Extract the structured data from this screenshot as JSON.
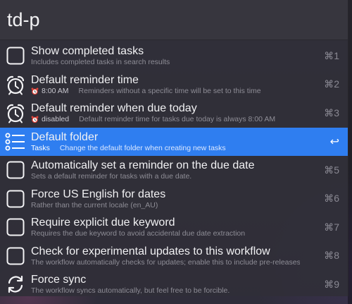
{
  "search": {
    "query": "td-p"
  },
  "results": [
    {
      "icon": "checkbox-icon",
      "title": "Show completed tasks",
      "prefix": "",
      "subtitle": "Includes completed tasks in search results",
      "shortcut": "⌘1",
      "selected": false
    },
    {
      "icon": "alarm-clock-icon",
      "title": "Default reminder time",
      "prefix": "8:00 AM",
      "subtitle": "Reminders without a specific time will be set to this time",
      "shortcut": "⌘2",
      "selected": false
    },
    {
      "icon": "alarm-clock-icon",
      "title": "Default reminder when due today",
      "prefix": "disabled",
      "subtitle": "Default reminder time for tasks due today is always 8:00 AM",
      "shortcut": "⌘3",
      "selected": false
    },
    {
      "icon": "list-icon",
      "title": "Default folder",
      "prefix": "Tasks",
      "subtitle": "Change the default folder when creating new tasks",
      "shortcut": "↩",
      "selected": true
    },
    {
      "icon": "checkbox-icon",
      "title": "Automatically set a reminder on the due date",
      "prefix": "",
      "subtitle": "Sets a default reminder for tasks with a due date.",
      "shortcut": "⌘5",
      "selected": false
    },
    {
      "icon": "checkbox-icon",
      "title": "Force US English for dates",
      "prefix": "",
      "subtitle": "Rather than the current locale (en_AU)",
      "shortcut": "⌘6",
      "selected": false
    },
    {
      "icon": "checkbox-icon",
      "title": "Require explicit due keyword",
      "prefix": "",
      "subtitle": "Requires the due keyword to avoid accidental due date extraction",
      "shortcut": "⌘7",
      "selected": false
    },
    {
      "icon": "checkbox-icon",
      "title": "Check for experimental updates to this workflow",
      "prefix": "",
      "subtitle": "The workflow automatically checks for updates; enable this to include pre-releases",
      "shortcut": "⌘8",
      "selected": false
    },
    {
      "icon": "sync-icon",
      "title": "Force sync",
      "prefix": "",
      "subtitle": "The workflow syncs automatically, but feel free to be forcible.",
      "shortcut": "⌘9",
      "selected": false
    }
  ],
  "colors": {
    "selection": "#2f7ef0",
    "panel": "#302f38",
    "title_text": "#f1f1f3",
    "subtitle_text": "#8e8d96",
    "clock_red": "#e0443a"
  }
}
